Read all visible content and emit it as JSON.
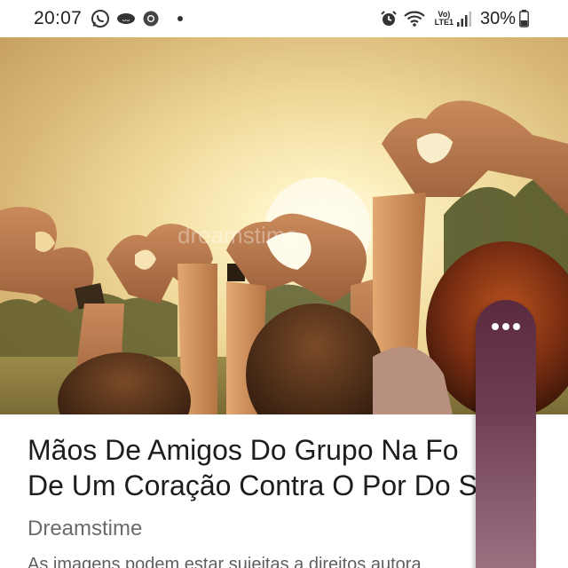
{
  "status_bar": {
    "time": "20:07",
    "left_icons": [
      "whatsapp-icon",
      "voicemail-icon",
      "chrome-icon",
      "notification-dot"
    ],
    "right_icons": [
      "alarm-icon",
      "wifi-icon",
      "volte-indicator",
      "signal-icon",
      "battery-icon"
    ],
    "volte_top": "Vo)",
    "volte_bottom": "LTE1",
    "battery": "30%"
  },
  "hero_image": {
    "description_icon": "hands-heart-sunset-photo",
    "watermark": "dreamstime"
  },
  "article": {
    "title": "Mãos De Amigos Do Grupo Na Fo\nDe Um Coração Contra O Por Do S",
    "source": "Dreamstime",
    "notice": "As imagens podem estar sujeitas a direitos autora"
  },
  "side_panel": {
    "menu_icon": "more-horizontal-icon"
  },
  "colors": {
    "side_panel_top": "#5a2a3e",
    "side_panel_bottom": "#9c7181",
    "title_text": "#1d1d1d",
    "source_text": "#6b6b6b"
  }
}
